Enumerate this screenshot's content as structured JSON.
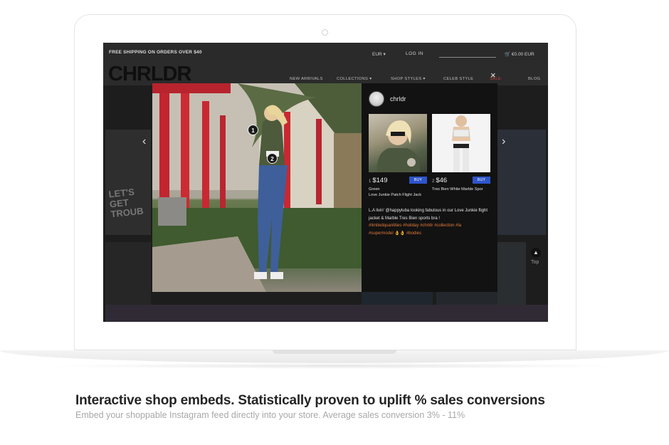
{
  "site": {
    "shipping_banner": "FREE SHIPPING ON ORDERS OVER $40",
    "currency": "EUR ▾",
    "login": "LOG IN",
    "cart_total": "€0.00 EUR",
    "logo": "CHRLDR",
    "nav": [
      "NEW ARRIVALS",
      "COLLECTIONS ▾",
      "SHOP STYLES ▾",
      "CELEB STYLE",
      "SALE",
      "BLOG"
    ],
    "top_label": "Top"
  },
  "modal": {
    "close": "×",
    "username": "chrldr",
    "hotspots": [
      "1",
      "2"
    ],
    "products": [
      {
        "index": "1",
        "price": "$149",
        "buy": "BUY",
        "desc_line1": "Green",
        "desc_line2": "Love Junkie Patch Flight Jack"
      },
      {
        "index": "2",
        "price": "$46",
        "buy": "BUY",
        "desc_line1": "Tres Bien White Marble Spor",
        "desc_line2": ""
      }
    ],
    "caption_text": "L.A livin' @happyluba looking fabulous in our Love Junkie flight jacket & Marble Tres Bien sports bra !",
    "hashtags": [
      "#limitedquantities",
      "#holiday",
      "#chrldr",
      "#collection",
      "#la",
      "#supermodel 👌👌",
      "#bodies"
    ]
  },
  "marketing": {
    "headline": "Interactive shop embeds. Statistically proven to uplift % sales conversions",
    "subline": "Embed your shoppable Instagram feed directly into your store. Average sales conversion 3% - 11%"
  },
  "colors": {
    "buy_button": "#2e55c9",
    "hashtag": "#e07a3c",
    "sale": "#c2443f",
    "panel_bg": "#121212"
  }
}
